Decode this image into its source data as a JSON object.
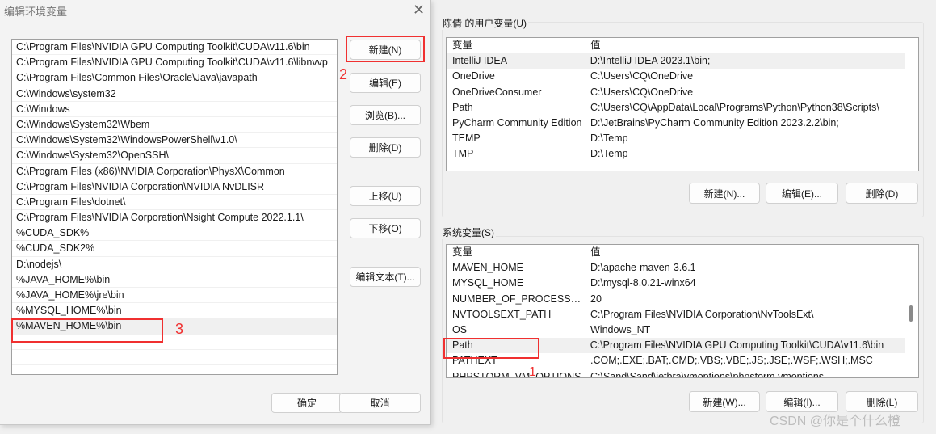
{
  "dialog": {
    "title": "编辑环境变量",
    "close_icon": "close-icon",
    "paths": [
      "C:\\Program Files\\NVIDIA GPU Computing Toolkit\\CUDA\\v11.6\\bin",
      "C:\\Program Files\\NVIDIA GPU Computing Toolkit\\CUDA\\v11.6\\libnvvp",
      "C:\\Program Files\\Common Files\\Oracle\\Java\\javapath",
      "C:\\Windows\\system32",
      "C:\\Windows",
      "C:\\Windows\\System32\\Wbem",
      "C:\\Windows\\System32\\WindowsPowerShell\\v1.0\\",
      "C:\\Windows\\System32\\OpenSSH\\",
      "C:\\Program Files (x86)\\NVIDIA Corporation\\PhysX\\Common",
      "C:\\Program Files\\NVIDIA Corporation\\NVIDIA NvDLISR",
      "C:\\Program Files\\dotnet\\",
      "C:\\Program Files\\NVIDIA Corporation\\Nsight Compute 2022.1.1\\",
      "%CUDA_SDK%",
      "%CUDA_SDK2%",
      "D:\\nodejs\\",
      "%JAVA_HOME%\\bin",
      "%JAVA_HOME%\\jre\\bin",
      "%MYSQL_HOME%\\bin",
      "%MAVEN_HOME%\\bin",
      "",
      ""
    ],
    "buttons": {
      "new": "新建(N)",
      "edit": "编辑(E)",
      "browse": "浏览(B)...",
      "delete": "删除(D)",
      "up": "上移(U)",
      "down": "下移(O)",
      "edit_text": "编辑文本(T)...",
      "ok": "确定",
      "cancel": "取消"
    }
  },
  "user_vars": {
    "label": "陈倩 的用户变量(U)",
    "headers": [
      "变量",
      "值"
    ],
    "rows": [
      [
        "IntelliJ IDEA",
        "D:\\IntelliJ IDEA 2023.1\\bin;"
      ],
      [
        "OneDrive",
        "C:\\Users\\CQ\\OneDrive"
      ],
      [
        "OneDriveConsumer",
        "C:\\Users\\CQ\\OneDrive"
      ],
      [
        "Path",
        "C:\\Users\\CQ\\AppData\\Local\\Programs\\Python\\Python38\\Scripts\\"
      ],
      [
        "PyCharm Community Edition",
        "D:\\JetBrains\\PyCharm Community Edition 2023.2.2\\bin;"
      ],
      [
        "TEMP",
        "D:\\Temp"
      ],
      [
        "TMP",
        "D:\\Temp"
      ]
    ],
    "buttons": {
      "new": "新建(N)...",
      "edit": "编辑(E)...",
      "delete": "删除(D)"
    }
  },
  "sys_vars": {
    "label": "系统变量(S)",
    "headers": [
      "变量",
      "值"
    ],
    "rows": [
      [
        "MAVEN_HOME",
        "D:\\apache-maven-3.6.1"
      ],
      [
        "MYSQL_HOME",
        "D:\\mysql-8.0.21-winx64"
      ],
      [
        "NUMBER_OF_PROCESSORS",
        "20"
      ],
      [
        "NVTOOLSEXT_PATH",
        "C:\\Program Files\\NVIDIA Corporation\\NvToolsExt\\"
      ],
      [
        "OS",
        "Windows_NT"
      ],
      [
        "Path",
        "C:\\Program Files\\NVIDIA GPU Computing Toolkit\\CUDA\\v11.6\\bin"
      ],
      [
        "PATHEXT",
        ".COM;.EXE;.BAT;.CMD;.VBS;.VBE;.JS;.JSE;.WSF;.WSH;.MSC"
      ],
      [
        "PHPSTORM_VM_OPTIONS",
        "C:\\Sand\\Sand\\jetbra\\vmoptions\\phpstorm.vmoptions"
      ]
    ],
    "buttons": {
      "new": "新建(W)...",
      "edit": "编辑(I)...",
      "delete": "删除(L)"
    }
  },
  "annotations": [
    "1",
    "2",
    "3"
  ],
  "watermark": "CSDN @你是个什么橙",
  "colors": {
    "highlight": "#f03030",
    "selected_row": "#f0f0f0"
  }
}
